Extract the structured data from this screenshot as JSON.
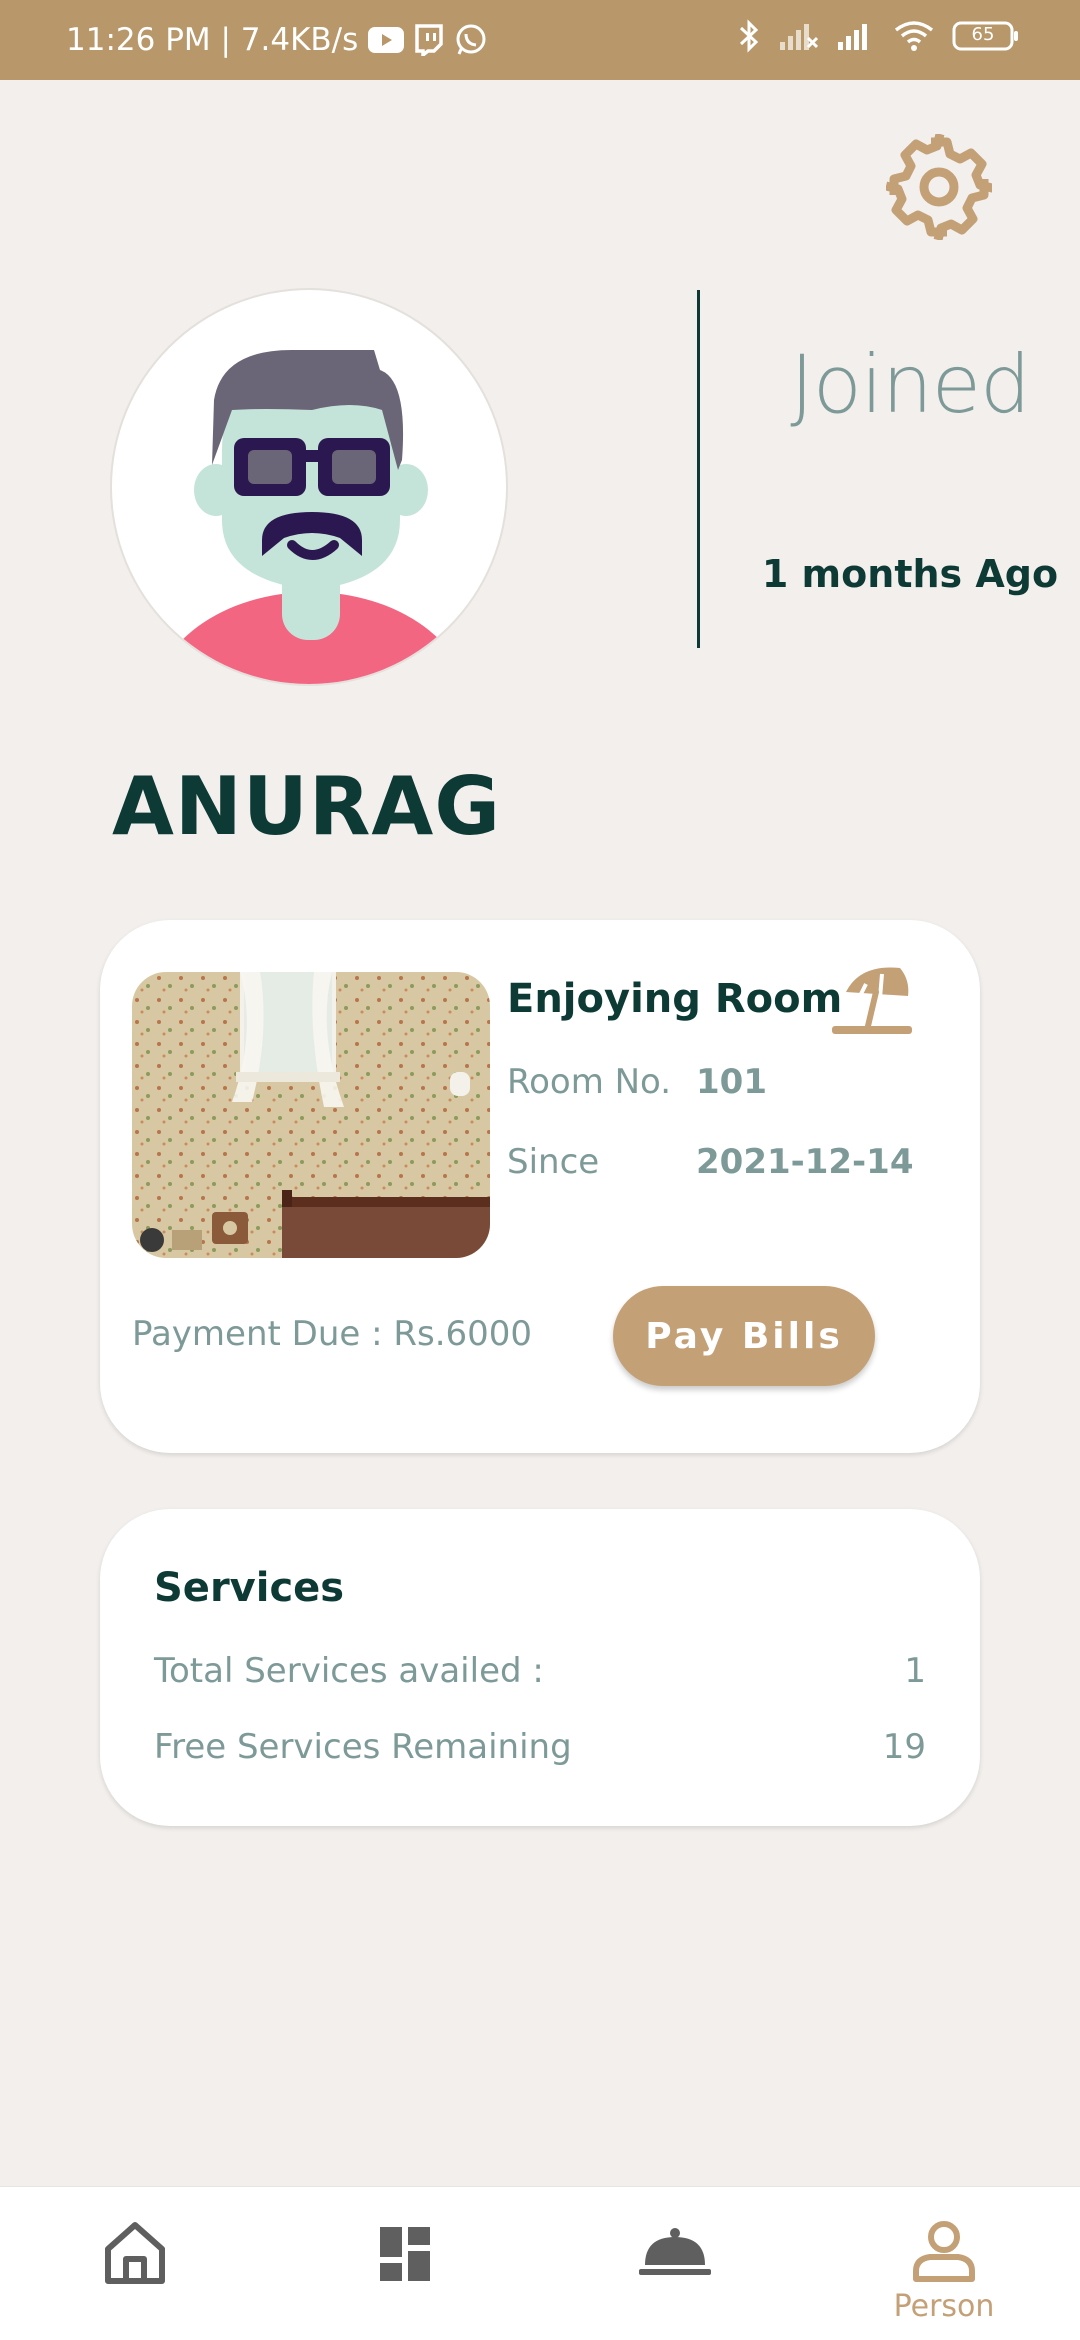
{
  "status_bar": {
    "time_speed": "11:26 PM | 7.4KB/s",
    "battery": "65",
    "left_icons": [
      "youtube-icon",
      "twitch-icon",
      "whatsapp-icon"
    ],
    "right_icons": [
      "bluetooth-icon",
      "signal-off-icon",
      "signal-icon",
      "wifi-icon",
      "battery-icon"
    ]
  },
  "colors": {
    "status_bar": "#b8976b",
    "accent": "#c4a077",
    "dark_green": "#0d3a35",
    "muted_text": "#7d9a98",
    "background": "#f2efec"
  },
  "profile": {
    "joined_label": "Joined",
    "joined_value": "1 months Ago",
    "name": "ANURAG"
  },
  "room_card": {
    "title": "Enjoying Room",
    "room_no_label": "Room No.",
    "room_no_value": "101",
    "since_label": "Since",
    "since_value": "2021-12-14",
    "payment_due": "Payment Due : Rs.6000",
    "pay_button": "Pay Bills"
  },
  "services_card": {
    "title": "Services",
    "rows": [
      {
        "label": "Total Services availed :",
        "value": "1"
      },
      {
        "label": "Free Services Remaining",
        "value": "19"
      }
    ]
  },
  "bottom_nav": {
    "items": [
      {
        "icon": "home-icon",
        "label": ""
      },
      {
        "icon": "dashboard-icon",
        "label": ""
      },
      {
        "icon": "room-service-icon",
        "label": ""
      },
      {
        "icon": "person-icon",
        "label": "Person"
      }
    ]
  }
}
